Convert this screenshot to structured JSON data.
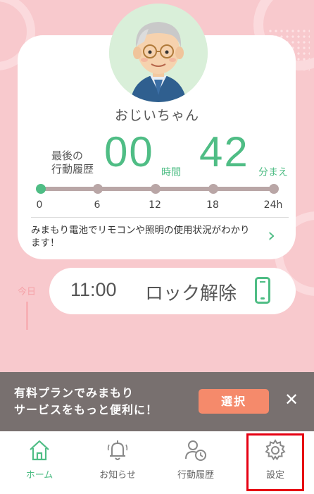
{
  "colors": {
    "accent": "#4fbd85",
    "background": "#f8c9cd",
    "banner": "#78706f",
    "banner_button": "#f58a6b",
    "highlight": "#e60012"
  },
  "profile": {
    "name": "おじいちゃん",
    "avatar_icon": "grandfather-avatar-icon"
  },
  "last_activity": {
    "label_line1": "最後の",
    "label_line2": "行動履歴",
    "hours": "00",
    "hours_unit": "時間",
    "minutes": "42",
    "minutes_unit": "分まえ",
    "timeline_ticks": [
      "0",
      "6",
      "12",
      "18",
      "24h"
    ],
    "elapsed_hours": 0.7
  },
  "info": {
    "text": "みまもり電池でリモコンや照明の使用状況がわかります！",
    "chevron_icon": "chevron-right-icon"
  },
  "timeline": {
    "today_label": "今日",
    "events": [
      {
        "time": "11:00",
        "text": "ロック解除",
        "icon": "smartphone-icon"
      }
    ]
  },
  "banner": {
    "line1": "有料プランでみまもり",
    "line2": "サービスをもっと便利に！",
    "button_label": "選択",
    "close_icon": "close-icon",
    "close_glyph": "✕"
  },
  "tabs": [
    {
      "label": "ホーム",
      "icon": "home-icon",
      "active": true
    },
    {
      "label": "お知らせ",
      "icon": "bell-icon",
      "active": false
    },
    {
      "label": "行動履歴",
      "icon": "user-clock-icon",
      "active": false
    },
    {
      "label": "設定",
      "icon": "gear-icon",
      "active": false,
      "highlighted": true
    }
  ]
}
